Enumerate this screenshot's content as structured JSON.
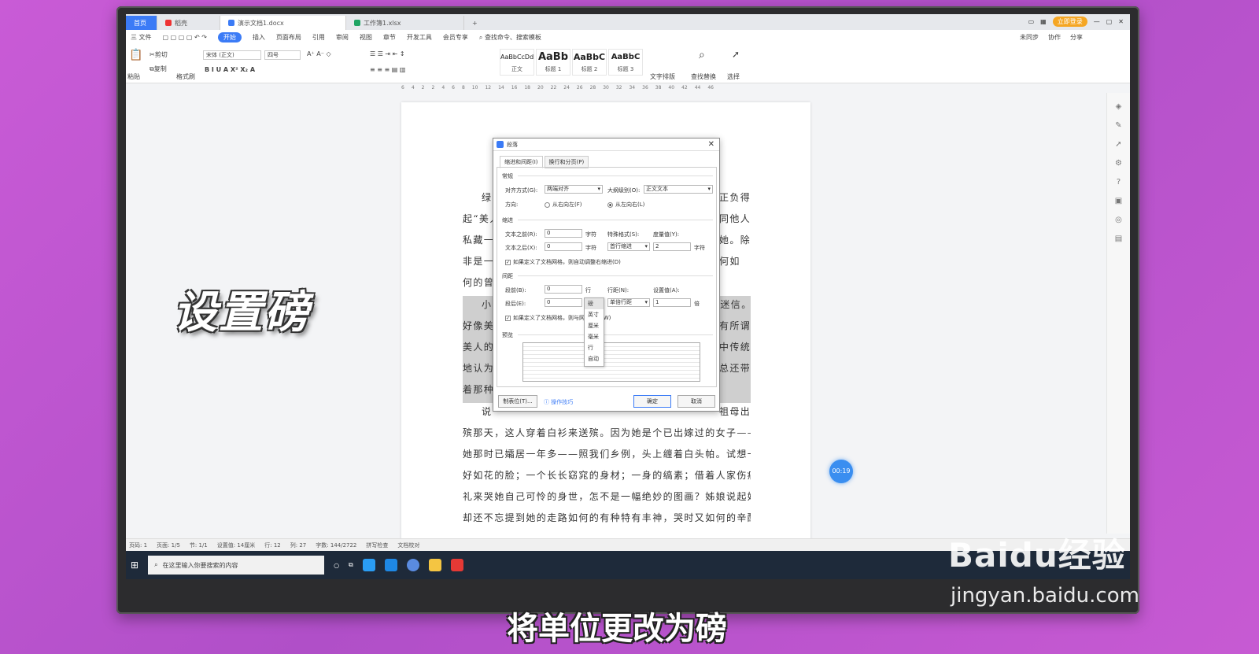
{
  "tabs": [
    {
      "label": "首页"
    },
    {
      "label": "稻壳"
    },
    {
      "label": "演示文档1.docx"
    },
    {
      "label": "工作簿1.xlsx"
    }
  ],
  "window": {
    "login": "立即登录"
  },
  "menu": {
    "items": [
      "三 文件",
      "开始",
      "插入",
      "页面布局",
      "引用",
      "审阅",
      "视图",
      "章节",
      "开发工具",
      "会员专享",
      "查找命令、搜索模板"
    ],
    "right": [
      "未同步",
      "协作",
      "分享"
    ]
  },
  "ribbon": {
    "paste": "粘贴",
    "cut": "剪切",
    "copy": "复制",
    "format_painter": "格式刷",
    "font": "宋体 (正文)",
    "size": "四号",
    "styles": [
      {
        "preview": "AaBbCcDd",
        "name": "正文"
      },
      {
        "preview": "AaBb",
        "name": "标题 1"
      },
      {
        "preview": "AaBbC",
        "name": "标题 2"
      },
      {
        "preview": "AaBbC",
        "name": "标题 3"
      }
    ],
    "text_layout": "文字排版",
    "find_replace": "查找替换",
    "select": "选择"
  },
  "ruler": [
    "6",
    "4",
    "2",
    "2",
    "4",
    "6",
    "8",
    "10",
    "12",
    "14",
    "16",
    "18",
    "20",
    "22",
    "24",
    "26",
    "28",
    "30",
    "32",
    "34",
    "36",
    "38",
    "40",
    "42",
    "44",
    "46"
  ],
  "document": {
    "lines": [
      "绿",
      "起“美人",
      "私藏一",
      "非是一",
      "何的曾",
      "小",
      "好像美",
      "美人的",
      "地认为",
      "着那种",
      "说",
      "殡那天，这人穿着白衫来送殡。因为她是个已出嫁过的女子——其实",
      "她那时已孀居一年多——照我们乡例，头上缠着白头帕。试想一个静",
      "好如花的脸；一个长长窈窕的身材；一身的缟素；借着人家伤痛的丧",
      "礼来哭她自己可怜的身世，怎不是一幅绝妙的图画？姊娘说起她时，",
      "却还不忘提到她的走路如何的有种特有丰神，哭时又如何的辛酸凄"
    ],
    "right_fragments": [
      "正负得",
      "同他人",
      "她。除",
      "何如",
      "来迷信。",
      "有所谓",
      "中传统",
      "总还带",
      "祖母出"
    ]
  },
  "dialog": {
    "title": "段落",
    "tab1": "缩进和间距(I)",
    "tab2": "换行和分页(P)",
    "general": "常规",
    "align_label": "对齐方式(G):",
    "align_value": "两端对齐",
    "outline_label": "大纲级别(O):",
    "outline_value": "正文文本",
    "direction_label": "方向:",
    "rtl": "从右向左(F)",
    "ltr": "从左向右(L)",
    "indent": "缩进",
    "before_text": "文本之前(R):",
    "before_text_val": "0",
    "after_text": "文本之后(X):",
    "after_text_val": "0",
    "unit_char": "字符",
    "special_label": "特殊格式(S):",
    "special_value": "首行缩进",
    "measure_label": "度量值(Y):",
    "measure_value": "2",
    "auto_adjust": "如果定义了文档网格，则自动调整右缩进(D)",
    "spacing": "间距",
    "space_before": "段前(B):",
    "space_before_val": "0",
    "line_unit": "行",
    "space_after": "段后(E):",
    "space_after_val": "0",
    "unit_selected": "磅",
    "line_spacing_label": "行距(N):",
    "line_spacing_value": "单倍行距",
    "setting_label": "设置值(A):",
    "setting_value": "1",
    "times": "倍",
    "snap_grid": "如果定义了文档网格，则与网格对齐(W)",
    "preview": "预览",
    "tabs_btn": "制表位(T)...",
    "tips": "操作技巧",
    "ok": "确定",
    "cancel": "取消"
  },
  "dropdown": [
    "磅",
    "英寸",
    "厘米",
    "毫米",
    "行",
    "自动"
  ],
  "status": [
    "页码: 1",
    "页面: 1/5",
    "节: 1/1",
    "设置值: 14厘米",
    "行: 12",
    "列: 27",
    "字数: 144/2722",
    "拼写检查",
    "文档校对"
  ],
  "taskbar": {
    "search_placeholder": "在这里输入你要搜索的内容"
  },
  "timer": "00:19",
  "overlay": {
    "caption": "设置磅",
    "subtitle": "将单位更改为磅",
    "watermark": "Baidu经验",
    "watermark_url": "jingyan.baidu.com"
  }
}
